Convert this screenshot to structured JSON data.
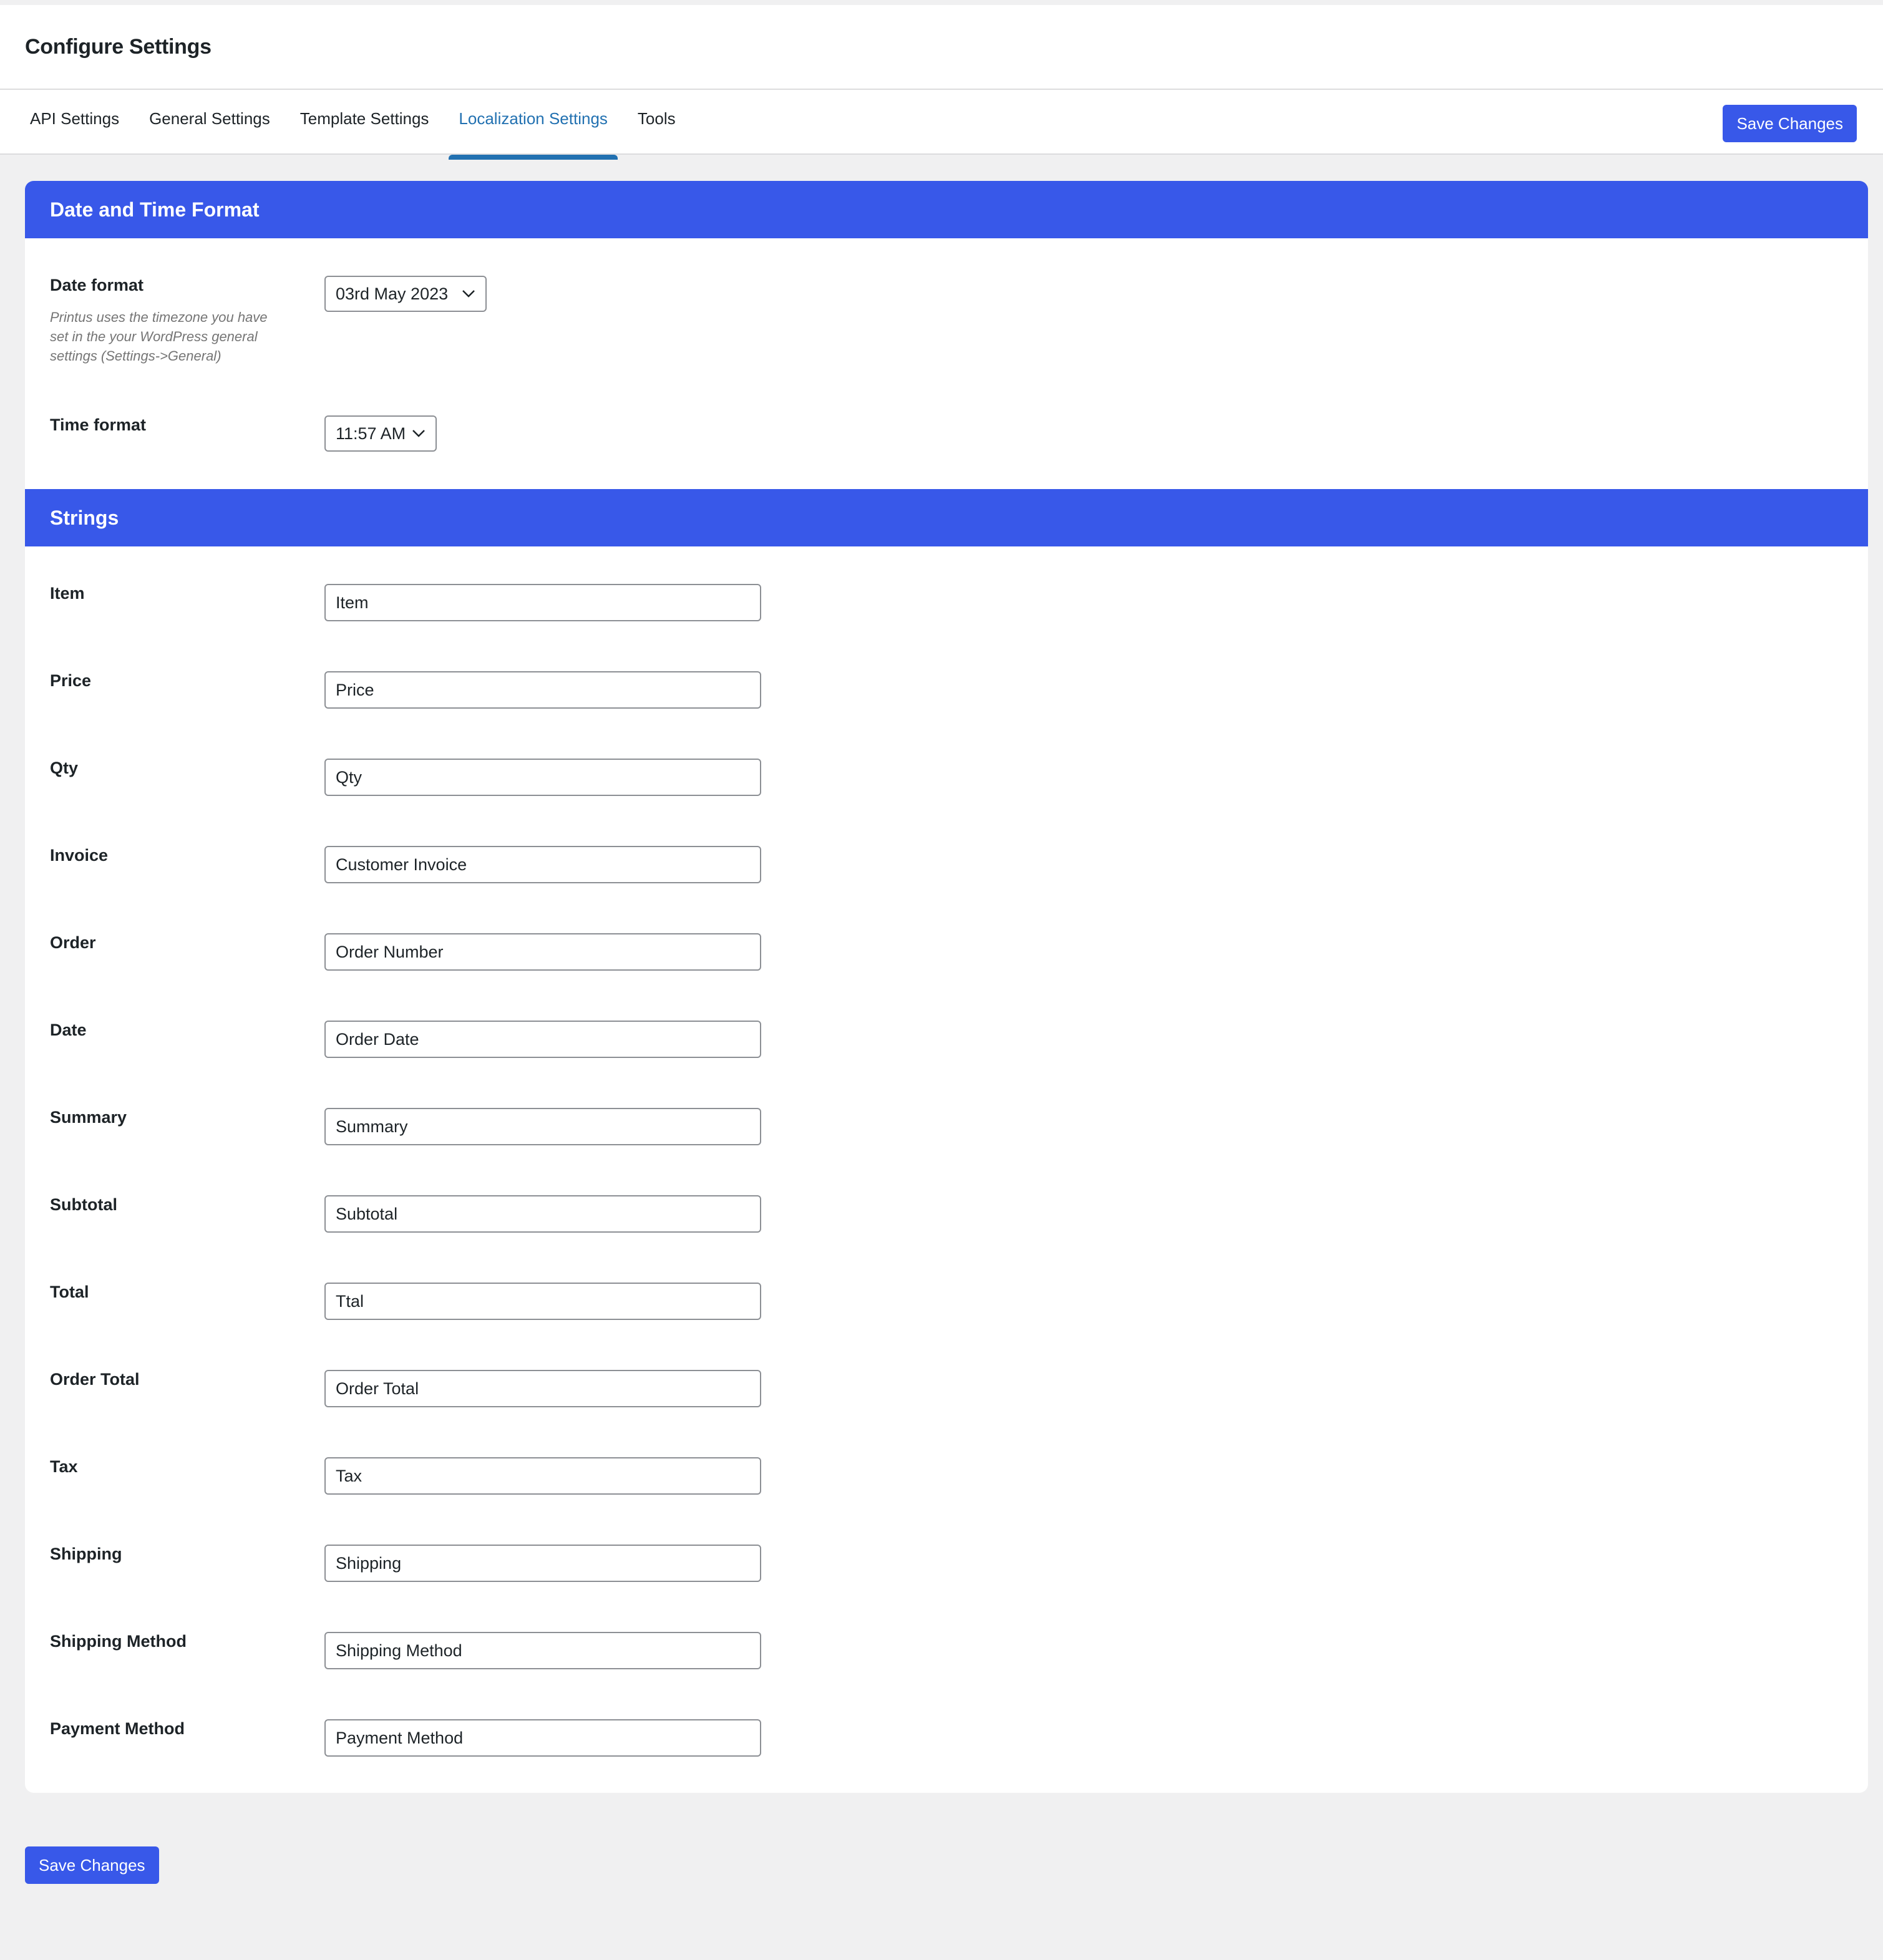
{
  "header": {
    "title": "Configure Settings"
  },
  "tabs": [
    {
      "label": "API Settings",
      "active": false
    },
    {
      "label": "General Settings",
      "active": false
    },
    {
      "label": "Template Settings",
      "active": false
    },
    {
      "label": "Localization Settings",
      "active": true
    },
    {
      "label": "Tools",
      "active": false
    }
  ],
  "toolbar": {
    "save_label": "Save Changes"
  },
  "colors": {
    "accent": "#3858e9",
    "tab_active": "#2271b1",
    "background": "#f0f0f1"
  },
  "date_time": {
    "title": "Date and Time Format",
    "date_format": {
      "label": "Date format",
      "value": "03rd May 2023",
      "description": "Printus uses the timezone you have set in the your WordPress general settings (Settings->General)"
    },
    "time_format": {
      "label": "Time format",
      "value": "11:57 AM"
    }
  },
  "strings": {
    "title": "Strings",
    "fields": [
      {
        "label": "Item",
        "value": "Item"
      },
      {
        "label": "Price",
        "value": "Price"
      },
      {
        "label": "Qty",
        "value": "Qty"
      },
      {
        "label": "Invoice",
        "value": "Customer Invoice"
      },
      {
        "label": "Order",
        "value": "Order Number"
      },
      {
        "label": "Date",
        "value": "Order Date"
      },
      {
        "label": "Summary",
        "value": "Summary"
      },
      {
        "label": "Subtotal",
        "value": "Subtotal"
      },
      {
        "label": "Total",
        "value": "Ttal"
      },
      {
        "label": "Order Total",
        "value": "Order Total"
      },
      {
        "label": "Tax",
        "value": "Tax"
      },
      {
        "label": "Shipping",
        "value": "Shipping"
      },
      {
        "label": "Shipping Method",
        "value": "Shipping Method"
      },
      {
        "label": "Payment Method",
        "value": "Payment Method"
      }
    ]
  },
  "footer": {
    "save_label": "Save Changes"
  }
}
